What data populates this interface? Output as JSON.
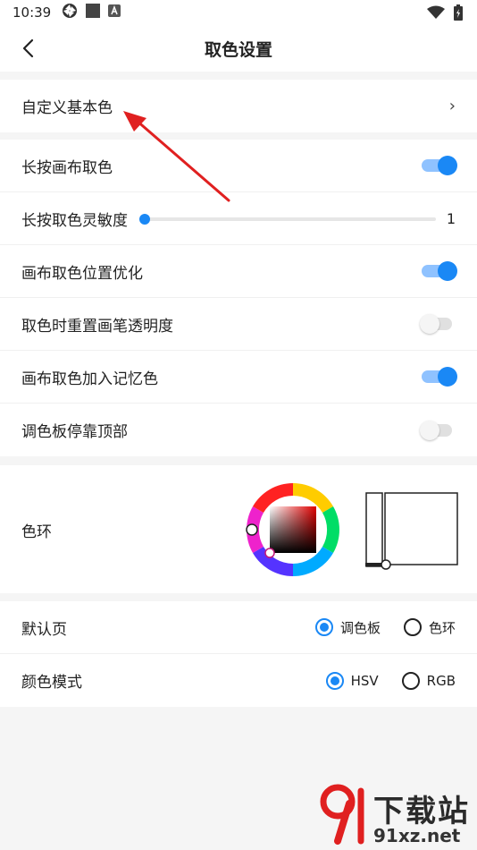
{
  "status_bar": {
    "time": "10:39"
  },
  "app_bar": {
    "title": "取色设置"
  },
  "custom_base": {
    "label": "自定义基本色",
    "chevron": "›"
  },
  "settings": [
    {
      "label": "长按画布取色",
      "type": "toggle",
      "on": true
    },
    {
      "label": "长按取色灵敏度",
      "type": "slider",
      "value": "1"
    },
    {
      "label": "画布取色位置优化",
      "type": "toggle",
      "on": true
    },
    {
      "label": "取色时重置画笔透明度",
      "type": "toggle",
      "on": false
    },
    {
      "label": "画布取色加入记忆色",
      "type": "toggle",
      "on": true
    },
    {
      "label": "调色板停靠顶部",
      "type": "toggle",
      "on": false
    }
  ],
  "color_wheel": {
    "label": "色环"
  },
  "default_page": {
    "label": "默认页",
    "options": [
      "调色板",
      "色环"
    ],
    "selected": "调色板"
  },
  "color_mode": {
    "label": "颜色模式",
    "options": [
      "HSV",
      "RGB"
    ],
    "selected": "HSV"
  },
  "watermark": {
    "brand": "下载站",
    "url": "91xz.net",
    "logo": "9l"
  },
  "colors": {
    "accent": "#1a88f5",
    "annotation_arrow": "#e02020"
  }
}
